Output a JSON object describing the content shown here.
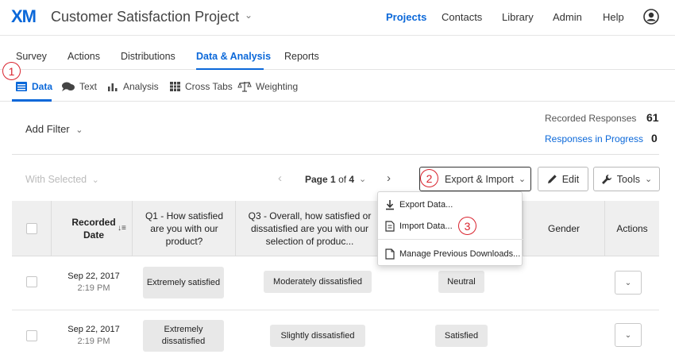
{
  "topbar": {
    "logo": "XM",
    "project_title": "Customer Satisfaction Project",
    "project_chevron": "⌄",
    "nav": [
      "Projects",
      "Contacts",
      "Library",
      "Admin",
      "Help"
    ]
  },
  "tabs": [
    "Survey",
    "Actions",
    "Distributions",
    "Data & Analysis",
    "Reports"
  ],
  "subtabs": [
    "Data",
    "Text",
    "Analysis",
    "Cross Tabs",
    "Weighting"
  ],
  "badges": [
    "1",
    "2",
    "3"
  ],
  "filter": {
    "label": "Add Filter",
    "chevron": "⌄"
  },
  "stats": {
    "recorded_label": "Recorded Responses",
    "recorded_value": "61",
    "progress_label": "Responses in Progress",
    "progress_value": "0"
  },
  "toolbar": {
    "with_selected": "With Selected",
    "with_selected_chevron": "⌄",
    "prev": "‹",
    "next": "›",
    "page_label": "Page",
    "page_current": "1",
    "page_of": "of",
    "page_total": "4",
    "page_chevron": "⌄",
    "export_import": "Export & Import",
    "export_chevron": "⌄",
    "edit": "Edit",
    "tools": "Tools",
    "tools_chevron": "⌄"
  },
  "dropdown": {
    "items": [
      "Export Data...",
      "Import Data...",
      "Manage Previous Downloads..."
    ]
  },
  "table": {
    "columns": [
      "Recorded Date",
      "Q1 - How satisfied are you with our product?",
      "Q3 - Overall, how satisfied or dissatisfied are you with our selection of produc...",
      "Gender",
      "Actions"
    ],
    "sort_icon": "↓≡",
    "rows": [
      {
        "date": "Sep 22, 2017",
        "time": "2:19 PM",
        "q1": "Extremely satisfied",
        "q3": "Moderately dissatisfied",
        "q4": "Neutral",
        "action": "⌄"
      },
      {
        "date": "Sep 22, 2017",
        "time": "2:19 PM",
        "q1": "Extremely dissatisfied",
        "q3": "Slightly dissatisfied",
        "q4": "Satisfied",
        "action": "⌄"
      }
    ]
  },
  "colors": {
    "brand_blue": "#0b68d9",
    "badge_red": "#d9232e",
    "header_gray": "#efefef",
    "chip_gray": "#e8e8e8"
  }
}
